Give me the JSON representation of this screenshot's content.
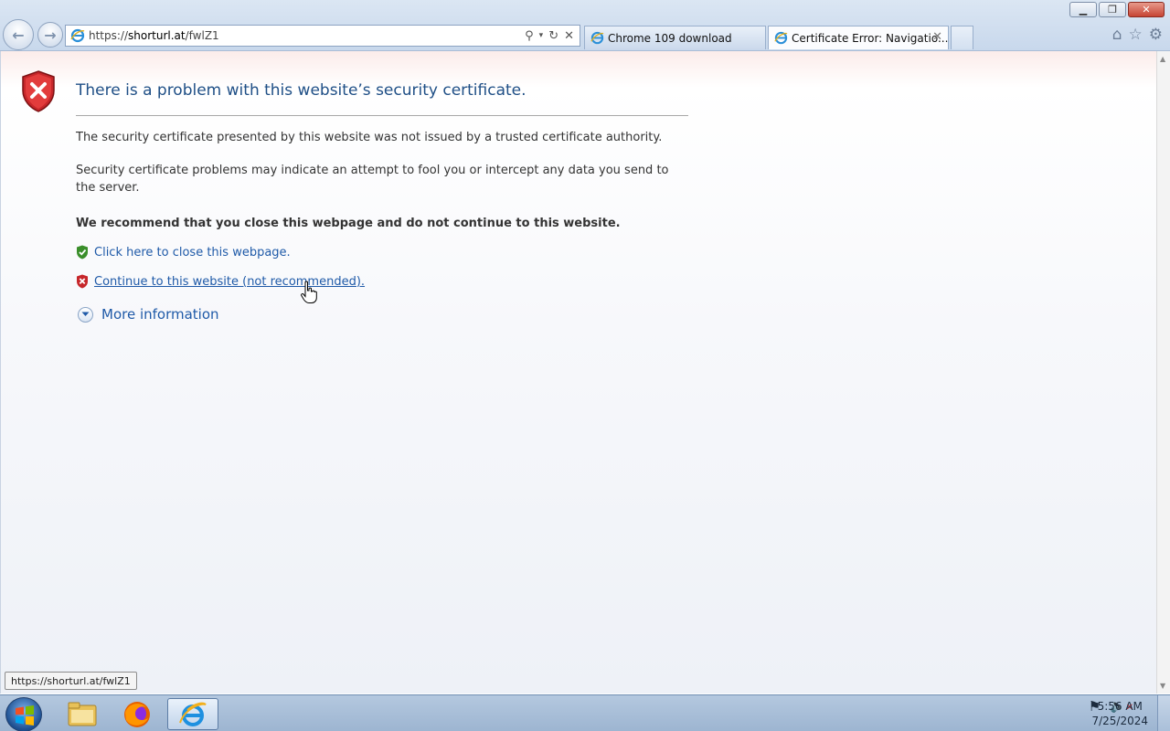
{
  "browser": {
    "address_url_prefix": "https://",
    "address_url_domain": "shorturl.at",
    "address_url_path": "/fwlZ1",
    "tabs": [
      {
        "label": "Chrome 109 download",
        "active": false
      },
      {
        "label": "Certificate Error: Navigatio...",
        "active": true
      }
    ],
    "icons": [
      "back-icon",
      "forward-icon",
      "search-icon",
      "refresh-icon",
      "stop-icon",
      "home-icon",
      "favorites-icon",
      "tools-gear-icon"
    ]
  },
  "page": {
    "title": "There is a problem with this website’s security certificate.",
    "para1": "The security certificate presented by this website was not issued by a trusted certificate authority.",
    "para2": "Security certificate problems may indicate an attempt to fool you or intercept any data you send to the server.",
    "recommend": "We recommend that you close this webpage and do not continue to this website.",
    "close_link": "Click here to close this webpage.",
    "continue_link": "Continue to this website (not recommended).",
    "more_info": "More information"
  },
  "status_tooltip": "https://shorturl.at/fwlZ1",
  "taskbar": {
    "time": "5:56 AM",
    "date": "7/25/2024",
    "apps": [
      "file-explorer",
      "firefox",
      "internet-explorer"
    ]
  },
  "colors": {
    "link": "#1f5aa8",
    "title": "#1f4f86",
    "error_red": "#c6262a",
    "ok_green": "#3a8e2a"
  }
}
